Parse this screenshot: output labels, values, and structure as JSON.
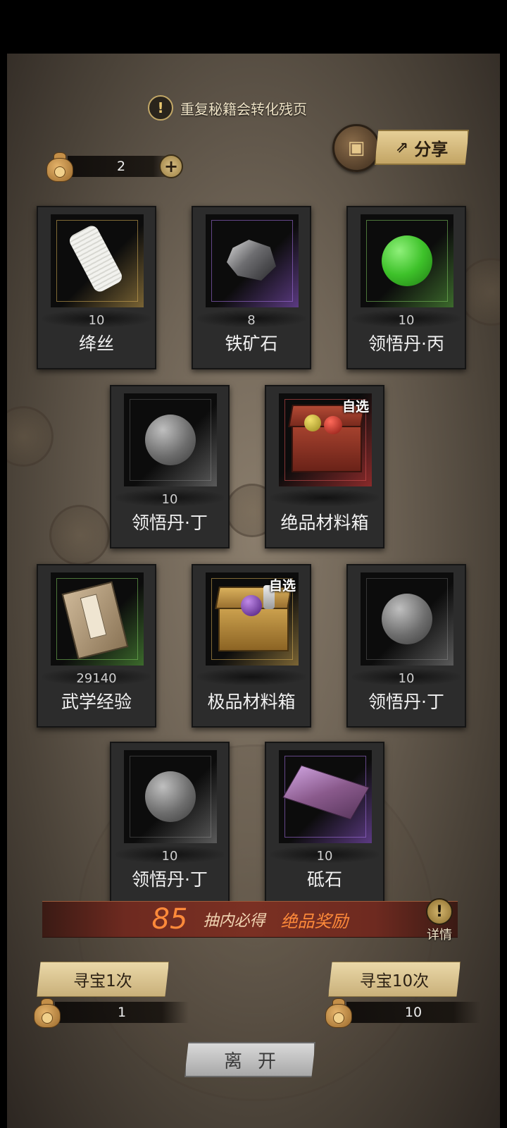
{
  "notice": {
    "icon": "exclamation-icon",
    "text": "重复秘籍会转化残页"
  },
  "share": {
    "label": "分享",
    "icon": "share-icon",
    "chest_icon": "treasure-chest-icon"
  },
  "currency": {
    "amount": "2",
    "add_icon": "plus-icon",
    "bag_icon": "money-bag-icon"
  },
  "items": [
    {
      "count": "10",
      "name": "绛丝",
      "rarity": "gold",
      "icon": "silk-spool-icon",
      "badge": ""
    },
    {
      "count": "8",
      "name": "铁矿石",
      "rarity": "purple",
      "icon": "iron-ore-icon",
      "badge": ""
    },
    {
      "count": "10",
      "name": "领悟丹·丙",
      "rarity": "green",
      "icon": "green-pill-icon",
      "badge": ""
    },
    {
      "count": "10",
      "name": "领悟丹·丁",
      "rarity": "gray",
      "icon": "gray-pill-icon",
      "badge": ""
    },
    {
      "count": "",
      "name": "绝品材料箱",
      "rarity": "red",
      "icon": "red-chest-icon",
      "badge": "自选"
    },
    {
      "count": "29140",
      "name": "武学经验",
      "rarity": "green",
      "icon": "martial-book-icon",
      "badge": ""
    },
    {
      "count": "",
      "name": "极品材料箱",
      "rarity": "gold",
      "icon": "gold-chest-icon",
      "badge": "自选"
    },
    {
      "count": "10",
      "name": "领悟丹·丁",
      "rarity": "gray",
      "icon": "gray-pill-icon",
      "badge": ""
    },
    {
      "count": "10",
      "name": "领悟丹·丁",
      "rarity": "gray",
      "icon": "gray-pill-icon",
      "badge": ""
    },
    {
      "count": "10",
      "name": "砥石",
      "rarity": "purple",
      "icon": "whetstone-icon",
      "badge": ""
    }
  ],
  "bonus": {
    "count": "85",
    "text1": "抽内必得",
    "text2": "绝品奖励",
    "detail_label": "详情",
    "detail_icon": "exclamation-icon"
  },
  "draw_once": {
    "label": "寻宝1次",
    "cost": "1"
  },
  "draw_ten": {
    "label": "寻宝10次",
    "cost": "10"
  },
  "leave": {
    "label": "离开"
  }
}
